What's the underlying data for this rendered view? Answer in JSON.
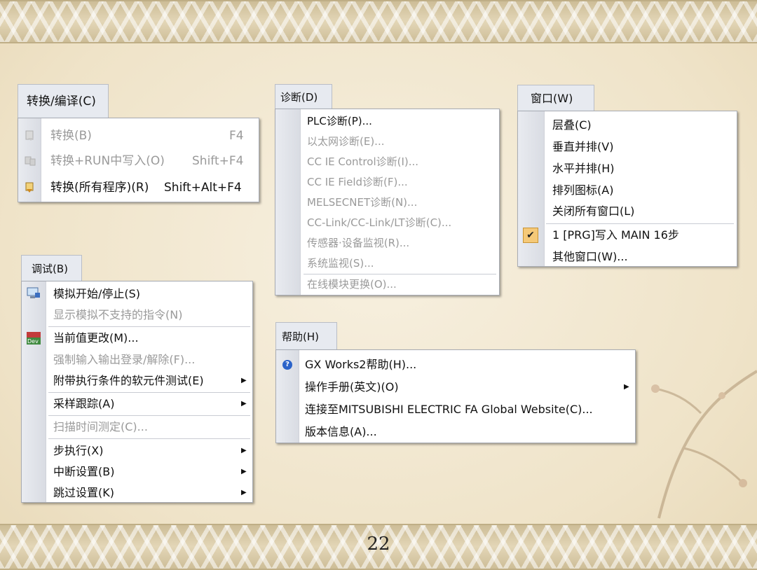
{
  "slide": {
    "page_number": "22"
  },
  "convert_menu": {
    "title": "转换/编译(C)",
    "items": [
      {
        "label": "转换(B)",
        "shortcut": "F4",
        "enabled": false,
        "icon": "convert-icon"
      },
      {
        "label": "转换+RUN中写入(O)",
        "shortcut": "Shift+F4",
        "enabled": false,
        "icon": "convert-run-icon"
      },
      {
        "label": "转换(所有程序)(R)",
        "shortcut": "Shift+Alt+F4",
        "enabled": true,
        "icon": "convert-all-icon"
      }
    ]
  },
  "diagnostics_menu": {
    "title": "诊断(D)",
    "items": [
      {
        "label": "PLC诊断(P)...",
        "enabled": true
      },
      {
        "label": "以太网诊断(E)...",
        "enabled": false
      },
      {
        "label": "CC IE Control诊断(I)...",
        "enabled": false
      },
      {
        "label": "CC IE Field诊断(F)...",
        "enabled": false
      },
      {
        "label": "MELSECNET诊断(N)...",
        "enabled": false
      },
      {
        "label": "CC-Link/CC-Link/LT诊断(C)...",
        "enabled": false
      },
      {
        "label": "传感器·设备监视(R)...",
        "enabled": false
      },
      {
        "label": "系统监视(S)...",
        "enabled": false
      },
      {
        "label": "在线模块更换(O)...",
        "enabled": false
      }
    ]
  },
  "window_menu": {
    "title": "窗口(W)",
    "items": [
      {
        "label": "层叠(C)",
        "enabled": true
      },
      {
        "label": "垂直并排(V)",
        "enabled": true
      },
      {
        "label": "水平并排(H)",
        "enabled": true
      },
      {
        "label": "排列图标(A)",
        "enabled": true
      },
      {
        "label": "关闭所有窗口(L)",
        "enabled": true
      },
      {
        "label": "1 [PRG]写入 MAIN 16步",
        "enabled": true,
        "checked": true
      },
      {
        "label": "其他窗口(W)...",
        "enabled": true
      }
    ]
  },
  "debug_menu": {
    "title": "调试(B)",
    "items": [
      {
        "label": "模拟开始/停止(S)",
        "enabled": true,
        "icon": "simulation-icon"
      },
      {
        "label": "显示模拟不支持的指令(N)",
        "enabled": false
      },
      {
        "label": "当前值更改(M)...",
        "enabled": true,
        "icon": "dev-icon"
      },
      {
        "label": "强制输入输出登录/解除(F)...",
        "enabled": false
      },
      {
        "label": "附带执行条件的软元件测试(E)",
        "enabled": true,
        "submenu": true
      },
      {
        "label": "采样跟踪(A)",
        "enabled": true,
        "submenu": true
      },
      {
        "label": "扫描时间测定(C)...",
        "enabled": false
      },
      {
        "label": "步执行(X)",
        "enabled": true,
        "submenu": true
      },
      {
        "label": "中断设置(B)",
        "enabled": true,
        "submenu": true
      },
      {
        "label": "跳过设置(K)",
        "enabled": true,
        "submenu": true
      }
    ]
  },
  "help_menu": {
    "title": "帮助(H)",
    "items": [
      {
        "label": "GX Works2帮助(H)...",
        "enabled": true,
        "icon": "help-icon"
      },
      {
        "label": "操作手册(英文)(O)",
        "enabled": true,
        "submenu": true
      },
      {
        "label": "连接至MITSUBISHI ELECTRIC FA Global Website(C)...",
        "enabled": true
      },
      {
        "label": "版本信息(A)...",
        "enabled": true
      }
    ]
  }
}
